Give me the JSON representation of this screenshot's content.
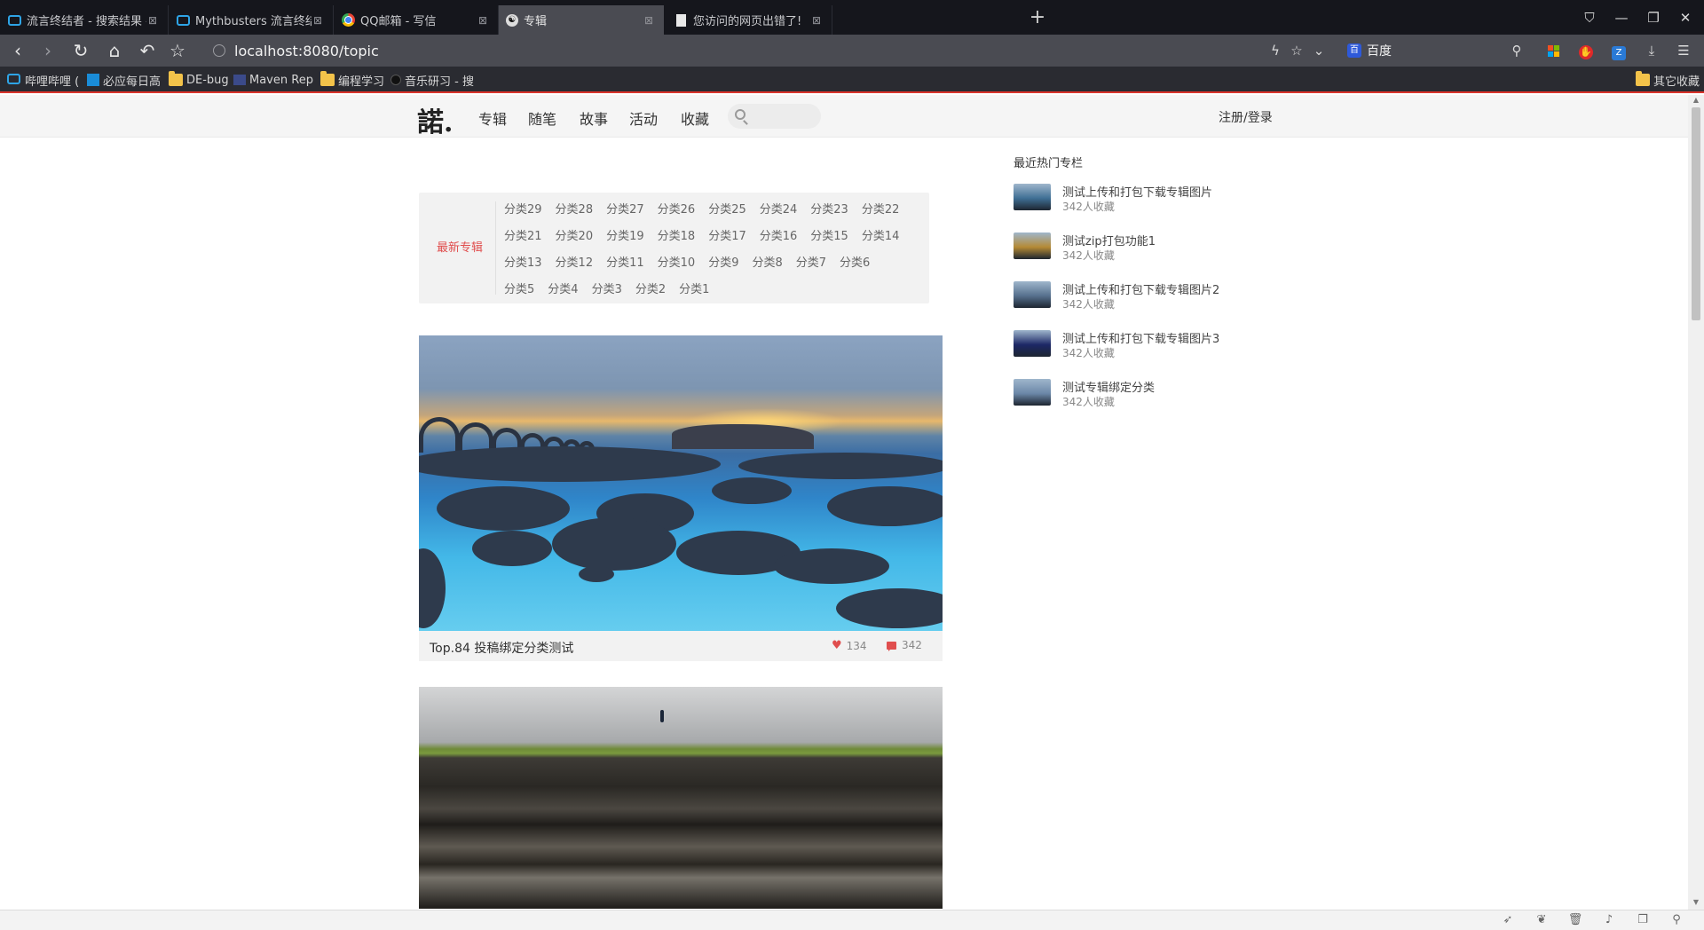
{
  "browser": {
    "tabs": [
      {
        "title": "流言终结者 - 搜索结果 - 哔哩哔",
        "icon": "bilibili-tv-icon"
      },
      {
        "title": "Mythbusters 流言终结者高清系",
        "icon": "bilibili-tv-icon"
      },
      {
        "title": "QQ邮箱 - 写信",
        "icon": "chrome-icon"
      },
      {
        "title": "专辑",
        "icon": "site-logo-icon",
        "active": true
      },
      {
        "title": "您访问的网页出错了!",
        "icon": "page-icon"
      }
    ],
    "new_tab_symbol": "+",
    "window_controls": {
      "shirt": "⛉",
      "minimize": "—",
      "restore": "❐",
      "close": "✕"
    },
    "nav": {
      "back": "‹",
      "forward": "›",
      "reload": "↻",
      "home": "⌂",
      "undo": "↶",
      "star": "☆"
    },
    "url": "localhost:8080/topic",
    "search_engine": "百度",
    "bookmarks": [
      {
        "label": "哔哩哔哩 (",
        "icon": "bilibili-tv-icon"
      },
      {
        "label": "必应每日高",
        "icon": "bing-icon"
      },
      {
        "label": "DE-bug",
        "icon": "folder-icon"
      },
      {
        "label": "Maven Rep",
        "icon": "maven-icon"
      },
      {
        "label": "编程学习",
        "icon": "folder-icon"
      },
      {
        "label": "音乐研习 - 搜",
        "icon": "music-icon"
      }
    ],
    "other_bookmarks": "其它收藏"
  },
  "site": {
    "logo": "諾.",
    "nav": [
      "专辑",
      "随笔",
      "故事",
      "活动",
      "收藏"
    ],
    "search_placeholder": "",
    "login": "注册/登录"
  },
  "categories": {
    "label": "最新专辑",
    "items": [
      "分类29",
      "分类28",
      "分类27",
      "分类26",
      "分类25",
      "分类24",
      "分类23",
      "分类22",
      "分类21",
      "分类20",
      "分类19",
      "分类18",
      "分类17",
      "分类16",
      "分类15",
      "分类14",
      "分类13",
      "分类12",
      "分类11",
      "分类10",
      "分类9",
      "分类8",
      "分类7",
      "分类6",
      "分类5",
      "分类4",
      "分类3",
      "分类2",
      "分类1"
    ]
  },
  "posts": [
    {
      "title": "Top.84 投稿绑定分类测试",
      "likes": "134",
      "comments": "342"
    },
    {
      "title": "",
      "likes": "",
      "comments": ""
    }
  ],
  "hot": {
    "title": "最近热门专栏",
    "items": [
      {
        "name": "测试上传和打包下载专辑图片",
        "count": "342人收藏",
        "color": "#3f6f94"
      },
      {
        "name": "测试zip打包功能1",
        "count": "342人收藏",
        "color": "#b58a35"
      },
      {
        "name": "测试上传和打包下载专辑图片2",
        "count": "342人收藏",
        "color": "#56708d"
      },
      {
        "name": "测试上传和打包下载专辑图片3",
        "count": "342人收藏",
        "color": "#1c2766"
      },
      {
        "name": "测试专辑绑定分类",
        "count": "342人收藏",
        "color": "#6b87a8"
      }
    ]
  },
  "statusbar": [
    "rocket-icon",
    "leaf-icon",
    "trash-icon",
    "speaker-icon",
    "window-icon",
    "search-icon"
  ]
}
